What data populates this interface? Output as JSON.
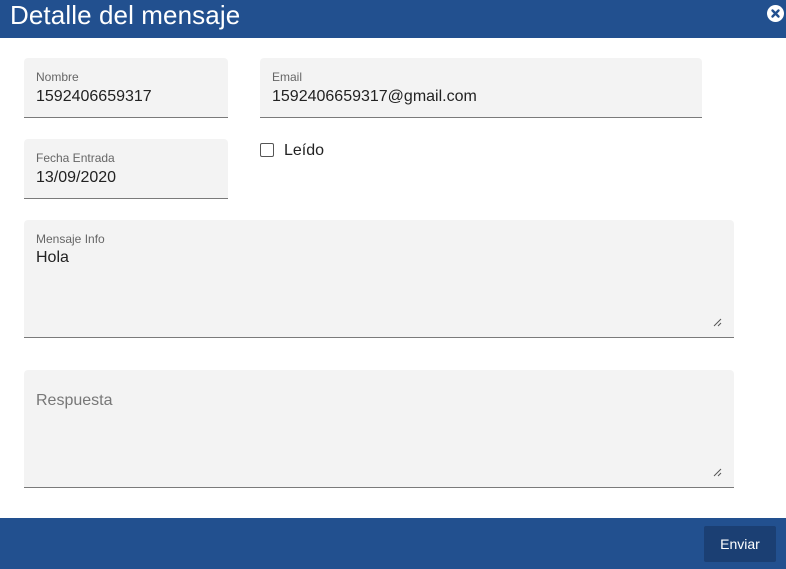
{
  "dialog": {
    "title": "Detalle del mensaje"
  },
  "form": {
    "nombre": {
      "label": "Nombre",
      "value": "1592406659317"
    },
    "email": {
      "label": "Email",
      "value": "1592406659317@gmail.com"
    },
    "fecha": {
      "label": "Fecha Entrada",
      "value": "13/09/2020"
    },
    "leido": {
      "label": "Leído",
      "checked": false
    },
    "mensaje": {
      "label": "Mensaje Info",
      "value": "Hola"
    },
    "respuesta": {
      "placeholder": "Respuesta"
    }
  },
  "footer": {
    "send_label": "Enviar"
  },
  "colors": {
    "header": "#22508f",
    "button": "#1b3f73",
    "field_bg": "#f3f3f3"
  }
}
